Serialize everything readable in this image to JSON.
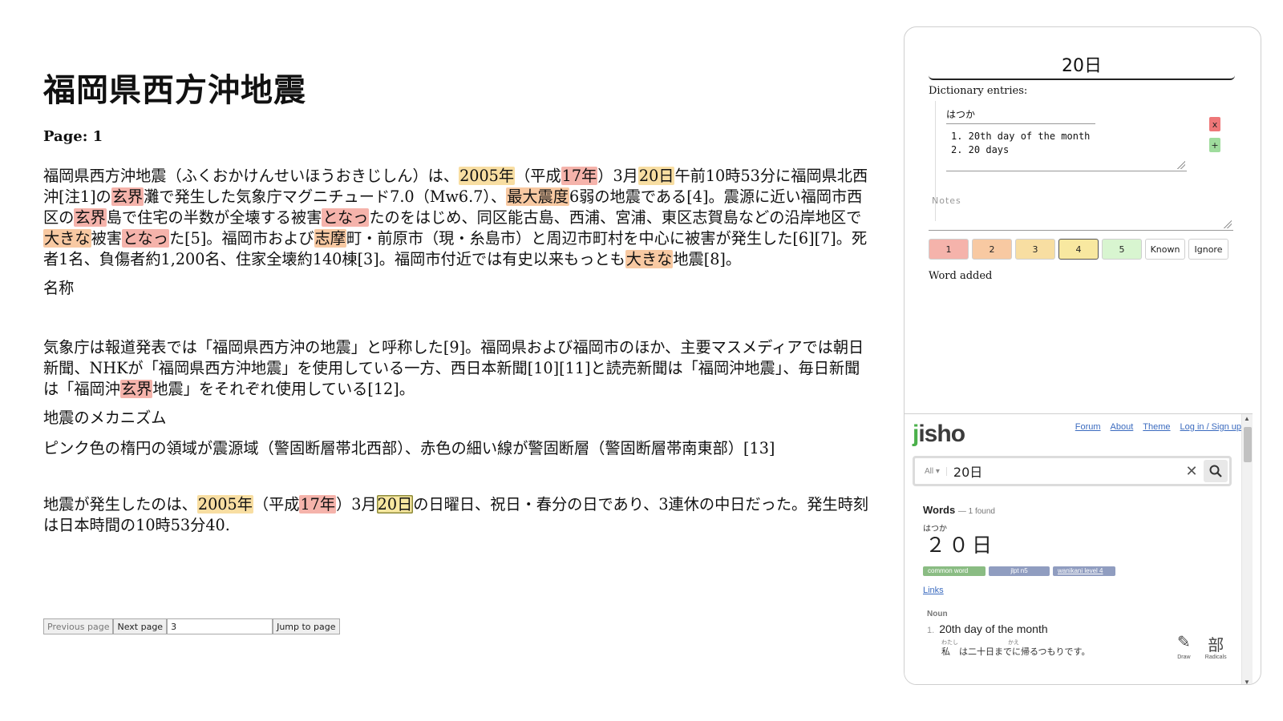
{
  "article": {
    "title": "福岡県西方沖地震",
    "page_indicator": "Page: 1",
    "p1": [
      {
        "t": "福岡県西方沖地震（ふくおかけんせいほうおきじしん）は、"
      },
      {
        "t": "2005年",
        "lvl": 3
      },
      {
        "t": "（平成"
      },
      {
        "t": "17年",
        "lvl": 1
      },
      {
        "t": "）3月"
      },
      {
        "t": "20日",
        "lvl": 3
      },
      {
        "t": "午前10時53分に福岡県北西沖[注1]の"
      },
      {
        "t": "玄界",
        "lvl": 1
      },
      {
        "t": "灘で発生した気象庁マグニチュード7.0（Mw6.7）、"
      },
      {
        "t": "最大震度",
        "lvl": 2
      },
      {
        "t": "6弱の地震である[4]。震源に近い福岡市西区の"
      },
      {
        "t": "玄界",
        "lvl": 1
      },
      {
        "t": "島で住宅の半数が全壊する被害"
      },
      {
        "t": "となっ",
        "lvl": 1
      },
      {
        "t": "たのをはじめ、同区能古島、西浦、宮浦、東区志賀島などの沿岸地区で"
      },
      {
        "t": "大きな",
        "lvl": 2
      },
      {
        "t": "被害"
      },
      {
        "t": "となっ",
        "lvl": 1
      },
      {
        "t": "た[5]。福岡市および"
      },
      {
        "t": "志摩",
        "lvl": 2
      },
      {
        "t": "町・前原市（現・糸島市）と周辺市町村を中心に被害が発生した[6][7]。死者1名、負傷者約1,200名、住家全壊約140棟[3]。福岡市付近では有史以来もっとも"
      },
      {
        "t": "大きな",
        "lvl": 2
      },
      {
        "t": "地震[8]。"
      }
    ],
    "heading1": "名称",
    "p2": [
      {
        "t": "気象庁は報道発表では「福岡県西方沖の地震」と呼称した[9]。福岡県および福岡市のほか、主要マスメディアでは朝日新聞、NHKが「福岡県西方沖地震」を使用している一方、西日本新聞[10][11]と読売新聞は「福岡沖地震」、毎日新聞は「福岡沖"
      },
      {
        "t": "玄界",
        "lvl": 1
      },
      {
        "t": "地震」をそれぞれ使用している[12]。"
      }
    ],
    "heading2": "地震のメカニズム",
    "p3": [
      {
        "t": "ピンク色の楕円の領域が震源域（警固断層帯北西部）、赤色の細い線が警固断層（警固断層帯南東部）[13]"
      }
    ],
    "p4": [
      {
        "t": "地震が発生したのは、"
      },
      {
        "t": "2005年",
        "lvl": 3
      },
      {
        "t": "（平成"
      },
      {
        "t": "17年",
        "lvl": 1
      },
      {
        "t": "）3月"
      },
      {
        "t": "20日",
        "lvl": 4
      },
      {
        "t": "の日曜日、祝日・春分の日であり、3連休の中日だった。発生時刻は日本時間の10時53分40."
      }
    ]
  },
  "pager": {
    "prev_label": "Previous page",
    "next_label": "Next page",
    "page_input": "3",
    "jump_label": "Jump to page"
  },
  "panel": {
    "word": "20日",
    "dict_label": "Dictionary entries:",
    "entry_reading": "はつか",
    "entry_defs": [
      "1. 20th day of the month",
      "2. 20 days"
    ],
    "remove_label": "x",
    "add_label": "+",
    "notes_placeholder": "Notes",
    "levels": [
      "1",
      "2",
      "3",
      "4",
      "5",
      "Known",
      "Ignore"
    ],
    "active_level": "4",
    "status": "Word added"
  },
  "jisho": {
    "logo": "jisho",
    "nav": [
      "Forum",
      "About",
      "Theme",
      "Log in / Sign up"
    ],
    "search_scope": "All ▾",
    "search_value": "20日",
    "words_label": "Words",
    "words_count": "— 1 found",
    "furigana": "はつか",
    "word": "２０日",
    "tags": [
      "common word",
      "jlpt n5",
      "wanikani level 4"
    ],
    "links": "Links",
    "pos": "Noun",
    "meaning_num": "1.",
    "meaning": "20th day of the month",
    "example_furi": "わたし かえ",
    "example": "私　は二十日までに帰るつもりです。",
    "tools": [
      {
        "glyph": "✎",
        "label": "Draw"
      },
      {
        "glyph": "部",
        "label": "Radicals"
      }
    ]
  },
  "colors": {
    "level1": "#f5b3ab",
    "level2": "#f8c9a2",
    "level3": "#f8dea2",
    "level4": "#f8e8a0",
    "level5": "#d8f5d0",
    "jisho_link": "#3b6bbf",
    "jisho_green": "#4bb04b"
  }
}
